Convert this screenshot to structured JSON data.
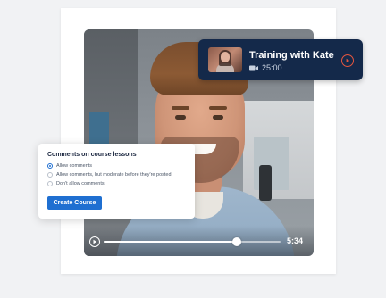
{
  "training_card": {
    "title": "Training with Kate",
    "duration": "25:00",
    "icons": {
      "thumbnail": "video-thumbnail",
      "meta": "video-camera-icon",
      "action": "play-circle-icon"
    }
  },
  "video_player": {
    "time": "5:34",
    "progress": 0.75,
    "icons": {
      "play": "play-circle-icon"
    }
  },
  "comments_panel": {
    "title": "Comments on course lessons",
    "options": [
      {
        "label": "Allow comments",
        "selected": true
      },
      {
        "label": "Allow comments, but moderate before they're posted",
        "selected": false
      },
      {
        "label": "Don't allow comments",
        "selected": false
      }
    ],
    "button_label": "Create Course"
  },
  "colors": {
    "accent_blue": "#1f6fd1",
    "navy": "#14294a",
    "play_red": "#e5563f"
  }
}
